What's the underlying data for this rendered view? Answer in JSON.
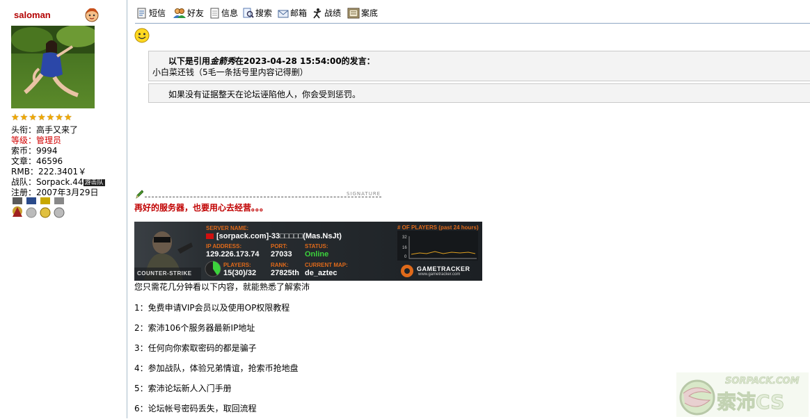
{
  "profile": {
    "username": "saloman",
    "stars": [
      "★",
      "★",
      "★",
      "★",
      "★",
      "★",
      "★"
    ],
    "title_label": "头衔：",
    "title_value": "高手又来了",
    "level_label": "等级：",
    "level_value": "管理员",
    "coins_label": "索币：",
    "coins_value": "9994",
    "posts_label": "文章：",
    "posts_value": "46596",
    "rmb_label": "RMB：",
    "rmb_value": "222.3401￥",
    "team_label": "战队：",
    "team_value": "Sorpack.44",
    "team_badge": "游击队",
    "reg_label": "注册：",
    "reg_value": "2007年3月29日"
  },
  "toolbar": [
    {
      "label": "短信",
      "icon": "message-icon"
    },
    {
      "label": "好友",
      "icon": "friends-icon"
    },
    {
      "label": "信息",
      "icon": "info-icon"
    },
    {
      "label": "搜索",
      "icon": "search-icon"
    },
    {
      "label": "邮箱",
      "icon": "mail-icon"
    },
    {
      "label": "战绩",
      "icon": "record-icon"
    },
    {
      "label": "案底",
      "icon": "file-icon"
    }
  ],
  "post": {
    "quote": {
      "prefix": "以下是引用",
      "author": "金箭秀",
      "mid": "在2023-04-28 15:54:00的发言：",
      "body": "小白菜还钱（5毛一条括号里内容记得删）"
    },
    "reply": "如果没有证据整天在论坛诬陷他人，你会受到惩罚。"
  },
  "signature": {
    "label": "SIGNATURE",
    "slogan": "再好的服务器，也要用心去经营。。。",
    "banner": {
      "server_name_label": "SERVER NAME:",
      "server_name": "[sorpack.com]-33□□□□□(Mas.NsJt)",
      "ip_label": "IP ADDRESS:",
      "ip": "129.226.173.74",
      "port_label": "PORT:",
      "port": "27033",
      "status_label": "STATUS:",
      "status": "Online",
      "players_label": "PLAYERS:",
      "players": "15(30)/32",
      "rank_label": "RANK:",
      "rank": "27825th",
      "map_label": "CURRENT MAP:",
      "map": "de_aztec",
      "graph_label": "# OF PLAYERS (past 24 hours)",
      "ticks": [
        "32",
        "16",
        "0"
      ],
      "logo_text": "COUNTER-STRIKE",
      "tracker": "GAMETRACKER",
      "tracker_url": "www.gametracker.com"
    },
    "intro": "您只需花几分钟看以下内容，就能熟悉了解索沛",
    "links": [
      "1：免费申请VIP会员以及使用OP权限教程",
      "2：索沛106个服务器最新IP地址",
      "3：任何向你索取密码的都是骗子",
      "4：参加战队，体验兄弟情谊，抢索币抢地盘",
      "5：索沛论坛新人入门手册",
      "6：论坛帐号密码丢失，取回流程"
    ]
  },
  "watermark": {
    "text": "SORPACK.COM",
    "cn": "索沛CS"
  },
  "colors": {
    "username": "#b30000",
    "level": "#d10000",
    "slogan": "#c00000",
    "border": "#a8bccb",
    "banner_bg": "#1f2428",
    "banner_label": "#e06a1a",
    "status_online": "#3cd23c"
  }
}
